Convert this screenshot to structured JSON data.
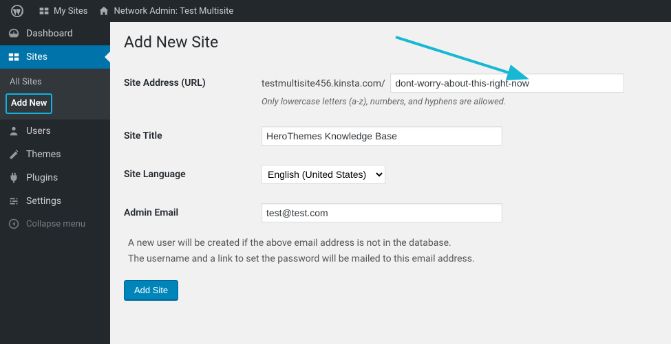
{
  "adminbar": {
    "my_sites": "My Sites",
    "network_title": "Network Admin: Test Multisite"
  },
  "menu": {
    "dashboard": "Dashboard",
    "sites": "Sites",
    "sites_sub": {
      "all": "All Sites",
      "add_new": "Add New"
    },
    "users": "Users",
    "themes": "Themes",
    "plugins": "Plugins",
    "settings": "Settings",
    "collapse": "Collapse menu"
  },
  "page": {
    "title": "Add New Site",
    "fields": {
      "address_label": "Site Address (URL)",
      "address_prefix": "testmultisite456.kinsta.com/",
      "address_value": "dont-worry-about-this-right-now",
      "address_hint": "Only lowercase letters (a-z), numbers, and hyphens are allowed.",
      "title_label": "Site Title",
      "title_value": "HeroThemes Knowledge Base",
      "language_label": "Site Language",
      "language_value": "English (United States)",
      "email_label": "Admin Email",
      "email_value": "test@test.com"
    },
    "notice_line1": "A new user will be created if the above email address is not in the database.",
    "notice_line2": "The username and a link to set the password will be mailed to this email address.",
    "submit": "Add Site"
  }
}
